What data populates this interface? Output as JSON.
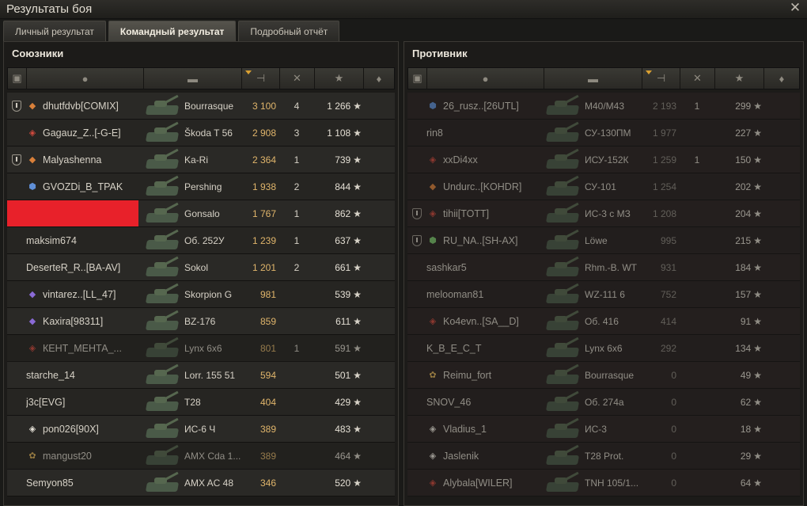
{
  "window": {
    "title": "Результаты боя"
  },
  "tabs": [
    {
      "label": "Личный результат",
      "active": false
    },
    {
      "label": "Командный результат",
      "active": true
    },
    {
      "label": "Подробный отчёт",
      "active": false
    }
  ],
  "allies": {
    "title": "Союзники",
    "rows": [
      {
        "platoon": true,
        "badge": "orange",
        "name": "dhutfdvb[COMIX]",
        "tank": "Bourrasque",
        "damage": "3 100",
        "kills": "4",
        "xp": "1 266",
        "dead": false
      },
      {
        "platoon": false,
        "badge": "red",
        "name": "Gagauz_Z..[-G-E]",
        "tank": "Škoda T 56",
        "damage": "2 908",
        "kills": "3",
        "xp": "1 108",
        "dead": false
      },
      {
        "platoon": true,
        "badge": "orange",
        "name": "Malyashenna",
        "tank": "Ka-Ri",
        "damage": "2 364",
        "kills": "1",
        "xp": "739",
        "dead": false
      },
      {
        "platoon": false,
        "badge": "blue",
        "name": "GVOZDi_B_TPAK",
        "tank": "Pershing",
        "damage": "1 938",
        "kills": "2",
        "xp": "844",
        "dead": false
      },
      {
        "platoon": false,
        "badge": "none",
        "name": "",
        "tank": "Gonsalo",
        "damage": "1 767",
        "kills": "1",
        "xp": "862",
        "dead": false,
        "redacted": true
      },
      {
        "platoon": false,
        "badge": "none",
        "name": "maksim674",
        "tank": "Об. 252У",
        "damage": "1 239",
        "kills": "1",
        "xp": "637",
        "dead": false
      },
      {
        "platoon": false,
        "badge": "none",
        "name": "DeserteR_R..[BA-AV]",
        "tank": "Sokol",
        "damage": "1 201",
        "kills": "2",
        "xp": "661",
        "dead": false
      },
      {
        "platoon": false,
        "badge": "purple",
        "name": "vintarez..[LL_47]",
        "tank": "Skorpion G",
        "damage": "981",
        "kills": "",
        "xp": "539",
        "dead": false
      },
      {
        "platoon": false,
        "badge": "purple",
        "name": "Kaxira[98311]",
        "tank": "BZ-176",
        "damage": "859",
        "kills": "",
        "xp": "611",
        "dead": false
      },
      {
        "platoon": false,
        "badge": "red",
        "name": "КЕНТ_МЕНТА_...",
        "tank": "Lynx 6x6",
        "damage": "801",
        "kills": "1",
        "xp": "591",
        "dead": true
      },
      {
        "platoon": false,
        "badge": "none",
        "name": "starche_14",
        "tank": "Lorr. 155 51",
        "damage": "594",
        "kills": "",
        "xp": "501",
        "dead": false
      },
      {
        "platoon": false,
        "badge": "none",
        "name": "j3c[EVG]",
        "tank": "T28",
        "damage": "404",
        "kills": "",
        "xp": "429",
        "dead": false
      },
      {
        "platoon": false,
        "badge": "white",
        "name": "pon026[90X]",
        "tank": "ИС-6 Ч",
        "damage": "389",
        "kills": "",
        "xp": "483",
        "dead": false
      },
      {
        "platoon": false,
        "badge": "gold",
        "name": "mangust20",
        "tank": "AMX Cda 1...",
        "damage": "389",
        "kills": "",
        "xp": "464",
        "dead": true
      },
      {
        "platoon": false,
        "badge": "none",
        "name": "Semyon85",
        "tank": "AMX AC 48",
        "damage": "346",
        "kills": "",
        "xp": "520",
        "dead": false
      }
    ]
  },
  "enemies": {
    "title": "Противник",
    "rows": [
      {
        "platoon": false,
        "badge": "blue",
        "name": "26_rusz..[26UTL]",
        "tank": "M40/M43",
        "damage": "2 193",
        "kills": "1",
        "xp": "299",
        "dead": true
      },
      {
        "platoon": false,
        "badge": "none",
        "name": "rin8",
        "tank": "СУ-130ПМ",
        "damage": "1 977",
        "kills": "",
        "xp": "227",
        "dead": true
      },
      {
        "platoon": false,
        "badge": "red",
        "name": "xxDi4xx",
        "tank": "ИСУ-152К",
        "damage": "1 259",
        "kills": "1",
        "xp": "150",
        "dead": true
      },
      {
        "platoon": false,
        "badge": "orange",
        "name": "Undurc..[KOHDR]",
        "tank": "СУ-101",
        "damage": "1 254",
        "kills": "",
        "xp": "202",
        "dead": true
      },
      {
        "platoon": true,
        "badge": "red",
        "name": "tihii[TOTT]",
        "tank": "ИС-3 с МЗ",
        "damage": "1 208",
        "kills": "",
        "xp": "204",
        "dead": true
      },
      {
        "platoon": true,
        "badge": "green",
        "name": "RU_NA..[SH-AX]",
        "tank": "Löwe",
        "damage": "995",
        "kills": "",
        "xp": "215",
        "dead": true
      },
      {
        "platoon": false,
        "badge": "none",
        "name": "sashkar5",
        "tank": "Rhm.-B. WT",
        "damage": "931",
        "kills": "",
        "xp": "184",
        "dead": true
      },
      {
        "platoon": false,
        "badge": "none",
        "name": "melooman81",
        "tank": "WZ-111 6",
        "damage": "752",
        "kills": "",
        "xp": "157",
        "dead": true
      },
      {
        "platoon": false,
        "badge": "red",
        "name": "Ko4evn..[SA__D]",
        "tank": "Об. 416",
        "damage": "414",
        "kills": "",
        "xp": "91",
        "dead": true
      },
      {
        "platoon": false,
        "badge": "none",
        "name": "K_B_E_C_T",
        "tank": "Lynx 6x6",
        "damage": "292",
        "kills": "",
        "xp": "134",
        "dead": true
      },
      {
        "platoon": false,
        "badge": "gold",
        "name": "Reimu_fort",
        "tank": "Bourrasque",
        "damage": "0",
        "kills": "",
        "xp": "49",
        "dead": true
      },
      {
        "platoon": false,
        "badge": "none",
        "name": "SNOV_46",
        "tank": "Об. 274а",
        "damage": "0",
        "kills": "",
        "xp": "62",
        "dead": true
      },
      {
        "platoon": false,
        "badge": "white",
        "name": "Vladius_1",
        "tank": "ИС-3",
        "damage": "0",
        "kills": "",
        "xp": "18",
        "dead": true
      },
      {
        "platoon": false,
        "badge": "white",
        "name": "Jaslenik",
        "tank": "T28 Prot.",
        "damage": "0",
        "kills": "",
        "xp": "29",
        "dead": true
      },
      {
        "platoon": false,
        "badge": "red",
        "name": "Alybala[WILER]",
        "tank": "TNH 105/1...",
        "damage": "0",
        "kills": "",
        "xp": "64",
        "dead": true
      }
    ]
  },
  "colors": {
    "damage_ally": "#e0b56b",
    "redacted": "#e8212a",
    "active_tab": "#55534c"
  },
  "icons": {
    "close": "close-icon",
    "platoon": "platoon-icon",
    "star": "star-icon"
  }
}
